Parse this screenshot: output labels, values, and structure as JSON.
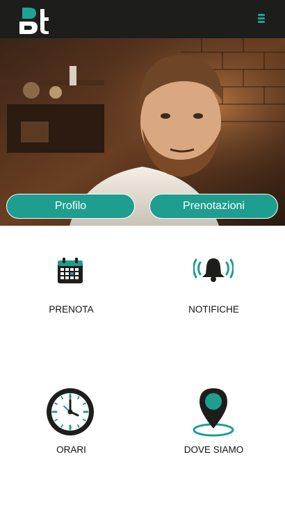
{
  "app": {
    "logo_icon": "bt-logo-icon",
    "menu_icon": "hamburger-menu-icon",
    "accent_color": "#1e9e8f",
    "topbar_color": "#1d1d1b"
  },
  "hero": {
    "image_icon": "barber-customer-photo",
    "buttons": {
      "profile_label": "Profilo",
      "bookings_label": "Prenotazioni"
    }
  },
  "tiles": [
    {
      "label": "PRENOTA",
      "icon": "calendar-icon"
    },
    {
      "label": "NOTIFICHE",
      "icon": "bell-ringing-icon"
    },
    {
      "label": "ORARI",
      "icon": "clock-icon"
    },
    {
      "label": "DOVE SIAMO",
      "icon": "map-pin-icon"
    }
  ]
}
